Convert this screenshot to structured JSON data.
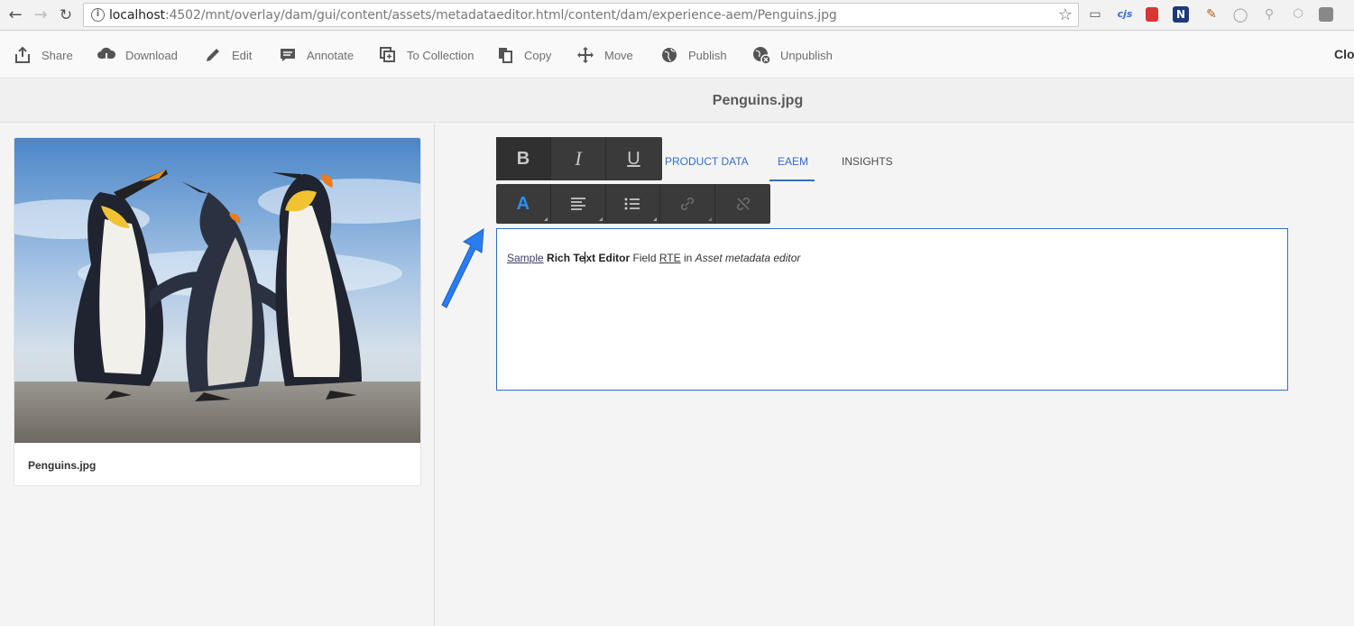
{
  "browser": {
    "url_host": "localhost",
    "url_rest": ":4502/mnt/overlay/dam/gui/content/assets/metadataeditor.html/content/dam/experience-aem/Penguins.jpg",
    "extensions": [
      "cast-icon",
      "cjs",
      "bookmark-red-icon",
      "n-icon",
      "pen-icon",
      "circle-icon",
      "search-icon",
      "angular-icon",
      "ext-icon"
    ]
  },
  "toolbar": {
    "share": "Share",
    "download": "Download",
    "edit": "Edit",
    "annotate": "Annotate",
    "to_collection": "To Collection",
    "copy": "Copy",
    "move": "Move",
    "publish": "Publish",
    "unpublish": "Unpublish",
    "close": "Clo"
  },
  "title": "Penguins.jpg",
  "card": {
    "title": "Penguins.jpg"
  },
  "tabs": {
    "product_data": "PRODUCT DATA",
    "eaem": "EAEM",
    "insights": "INSIGHTS"
  },
  "rte": {
    "bold": "B",
    "italic": "I",
    "underline": "U",
    "text_color": "A"
  },
  "editor": {
    "sample": "Sample",
    "rich": "Rich Te",
    "xt_editor": "xt Editor",
    "field": " Field ",
    "rte": "RTE",
    "in": " in ",
    "asset": "Asset metadata editor"
  },
  "colors": {
    "accent": "#326ec8",
    "rte_bg": "#3a3a3a",
    "arrow": "#2a7df0"
  }
}
